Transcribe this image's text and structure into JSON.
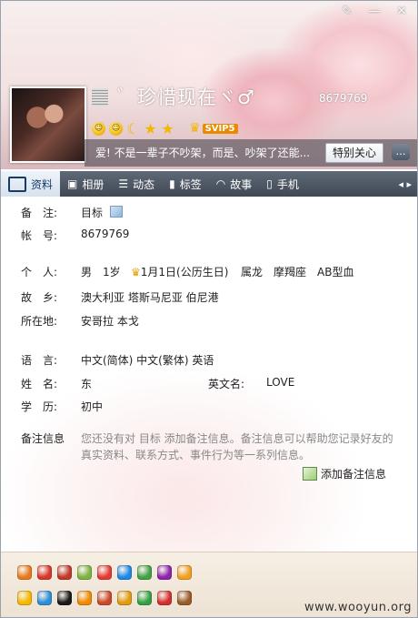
{
  "window": {
    "controls": [
      "skin-icon",
      "minimize",
      "close"
    ]
  },
  "profile": {
    "nickname": "゛珍惜现在ヾ♂",
    "qq_number": "8679769",
    "level_icons": [
      "sun-icon",
      "sun-icon",
      "moon-icon",
      "star-icon",
      "star-icon"
    ],
    "svip_label": "SVIP5",
    "signature": "爱! 不是一辈子不吵架，而是、吵架了还能...",
    "care_button": "特别关心"
  },
  "tabs": [
    {
      "label": "资料",
      "icon": "profile-card-icon",
      "active": true
    },
    {
      "label": "相册",
      "icon": "photo-album-icon",
      "active": false
    },
    {
      "label": "动态",
      "icon": "feed-list-icon",
      "active": false
    },
    {
      "label": "标签",
      "icon": "bookmark-tag-icon",
      "active": false
    },
    {
      "label": "故事",
      "icon": "rainbow-story-icon",
      "active": false
    },
    {
      "label": "手机",
      "icon": "phone-icon",
      "active": false
    }
  ],
  "info": {
    "remark_label": "备　注:",
    "remark_value": "目标",
    "account_label": "帐　号:",
    "account_value": "8679769",
    "personal_label": "个　人:",
    "gender": "男",
    "age": "1岁",
    "birthday": "1月1日(公历生日)",
    "zodiac": "属龙",
    "constellation": "摩羯座",
    "blood_type": "AB型血",
    "hometown_label": "故　乡:",
    "hometown_value": "澳大利亚 塔斯马尼亚 伯尼港",
    "location_label": "所在地:",
    "location_value": "安哥拉 本戈",
    "language_label": "语　言:",
    "language_value": "中文(简体) 中文(繁体) 英语",
    "name_label": "姓　名:",
    "name_value": "东",
    "english_name_label": "英文名:",
    "english_name_value": "LOVE",
    "education_label": "学　历:",
    "education_value": "初中",
    "remark_info_label": "备注信息",
    "remark_info_text": "您还没有对 目标 添加备注信息。备注信息可以帮助您记录好友的真实资料、联系方式、事件行为等一系列信息。",
    "add_remark_label": "添加备注信息"
  },
  "badges_row1": [
    {
      "icon": "qq-show-icon",
      "color": "#e77a1f"
    },
    {
      "icon": "diamond-red-icon",
      "color": "#d8362b"
    },
    {
      "icon": "game-icon",
      "color": "#c0392b"
    },
    {
      "icon": "green-diamond-icon",
      "color": "#7cb342"
    },
    {
      "icon": "red-diamond-icon",
      "color": "#e53935"
    },
    {
      "icon": "blue-diamond-icon",
      "color": "#1e88e5"
    },
    {
      "icon": "pink-diamond-icon",
      "color": "#43a047"
    },
    {
      "icon": "purple-diamond-icon",
      "color": "#8e24aa"
    },
    {
      "icon": "vip-gift-icon",
      "color": "#f0a020"
    }
  ],
  "badges_row2": [
    {
      "icon": "star-badge-icon",
      "color": "#f5b800"
    },
    {
      "icon": "qzone-icon",
      "color": "#2b8fd6"
    },
    {
      "icon": "penguin-icon",
      "color": "#1a1a1a"
    },
    {
      "icon": "qzone-gold-icon",
      "color": "#f08a00"
    },
    {
      "icon": "mail-icon",
      "color": "#c84a2a"
    },
    {
      "icon": "shield-icon",
      "color": "#e29a10"
    },
    {
      "icon": "music-icon",
      "color": "#35a043"
    },
    {
      "icon": "red-bag-icon",
      "color": "#d32f2f"
    },
    {
      "icon": "pet-icon",
      "color": "#9a5b2a"
    }
  ],
  "watermark": "www.wooyun.org"
}
